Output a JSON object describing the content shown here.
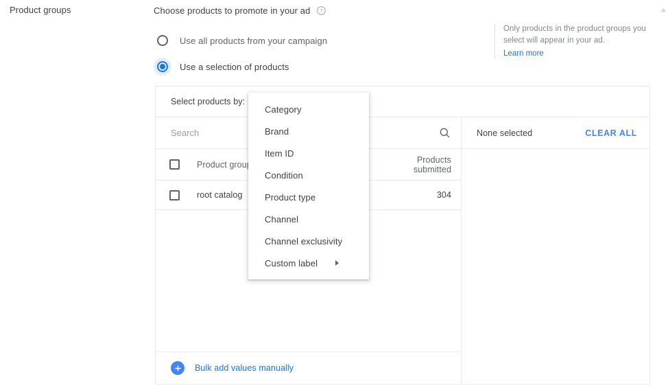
{
  "section": {
    "label": "Product groups"
  },
  "heading": {
    "title": "Choose products to promote in your ad",
    "help_icon": "help-circle-icon"
  },
  "radio_options": [
    {
      "label": "Use all products from your campaign",
      "selected": false
    },
    {
      "label": "Use a selection of products",
      "selected": true
    }
  ],
  "info_note": {
    "text": "Only products in the product groups you select will appear in your ad.",
    "link_label": "Learn more"
  },
  "card": {
    "header_label": "Select products by:",
    "search": {
      "placeholder": "Search",
      "value": "",
      "icon": "search-icon"
    },
    "table": {
      "columns": [
        "Product group",
        "Products\nsubmitted"
      ],
      "column_product_group": "Product group",
      "column_products_submitted_line1": "Products",
      "column_products_submitted_line2": "submitted",
      "rows": [
        {
          "name": "root catalog",
          "products_submitted": "304",
          "checked": false
        }
      ]
    },
    "bulk_add": {
      "icon": "plus-circle-icon",
      "label": "Bulk add values manually"
    },
    "selection_panel": {
      "status": "None selected",
      "clear_all_label": "CLEAR ALL"
    }
  },
  "dropdown_menu": {
    "items": [
      {
        "label": "Category",
        "has_submenu": false
      },
      {
        "label": "Brand",
        "has_submenu": false
      },
      {
        "label": "Item ID",
        "has_submenu": false
      },
      {
        "label": "Condition",
        "has_submenu": false
      },
      {
        "label": "Product type",
        "has_submenu": false
      },
      {
        "label": "Channel",
        "has_submenu": false
      },
      {
        "label": "Channel exclusivity",
        "has_submenu": false
      },
      {
        "label": "Custom label",
        "has_submenu": true
      }
    ]
  },
  "colors": {
    "accent_blue": "#1a73e8",
    "link_blue": "#4285f4",
    "text_primary": "#3c4043",
    "text_secondary": "#5f6368",
    "border": "#e8eaed"
  }
}
